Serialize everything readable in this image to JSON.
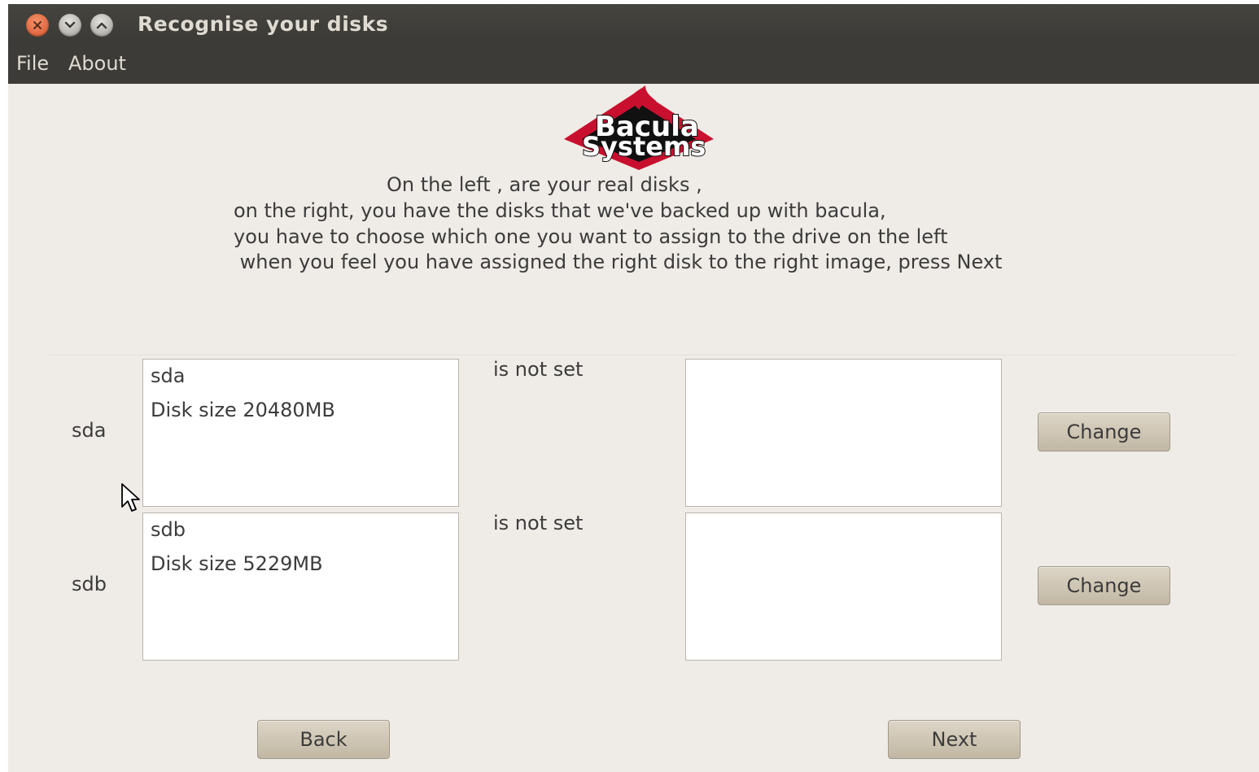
{
  "window": {
    "title": "Recognise your disks",
    "buttons": {
      "close": "close-icon",
      "minimize": "minimize-icon",
      "maximize": "maximize-icon"
    }
  },
  "menubar": {
    "items": [
      {
        "label": "File"
      },
      {
        "label": "About"
      }
    ]
  },
  "logo": {
    "text_line1": "Bacula",
    "text_line2": "Systems",
    "colors": {
      "red": "#c8102e",
      "black": "#111111",
      "white": "#ffffff"
    }
  },
  "instructions": {
    "lines": [
      "On the left , are your real disks ,",
      "on the right, you have the disks that we've backed up with bacula,",
      "you have to choose which one you want to assign to the drive on the left",
      " when you feel you have assigned the right disk to the right image, press Next"
    ]
  },
  "disks": [
    {
      "label": "sda",
      "name": "sda",
      "size": "Disk size 20480MB",
      "status": "is not set",
      "change_label": "Change"
    },
    {
      "label": "sdb",
      "name": "sdb",
      "size": "Disk size 5229MB",
      "status": "is not set",
      "change_label": "Change"
    }
  ],
  "navigation": {
    "back_label": "Back",
    "next_label": "Next"
  }
}
